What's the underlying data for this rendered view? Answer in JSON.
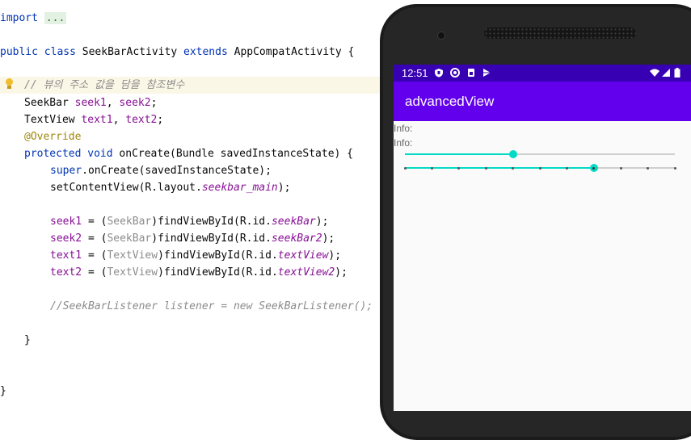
{
  "editor": {
    "line1": {
      "kw": "import",
      "fold": "..."
    },
    "line2": {
      "kw1": "public",
      "kw2": "class",
      "name": "SeekBarActivity",
      "kw3": "extends",
      "parent": "AppCompatActivity",
      "brace": "{"
    },
    "comment": "// 뷰의 주소 값을 담을 참조변수",
    "line4": {
      "type": "SeekBar",
      "a": "seek1",
      "sep": ", ",
      "b": "seek2",
      "end": ";"
    },
    "line5": {
      "type": "TextView",
      "a": "text1",
      "sep": ", ",
      "b": "text2",
      "end": ";"
    },
    "annotation": "@Override",
    "line7": {
      "kw1": "protected",
      "kw2": "void",
      "rest": "onCreate(Bundle savedInstanceState) {"
    },
    "line8": {
      "kw": "super",
      "rest": ".onCreate(savedInstanceState);"
    },
    "line9": {
      "pre": "setContentView(R.layout.",
      "ital": "seekbar_main",
      "post": ");"
    },
    "assign": [
      {
        "field": "seek1",
        "open": " = (",
        "cast": "SeekBar",
        "mid": ")findViewById(R.id.",
        "id": "seekBar",
        "close": ");"
      },
      {
        "field": "seek2",
        "open": " = (",
        "cast": "SeekBar",
        "mid": ")findViewById(R.id.",
        "id": "seekBar2",
        "close": ");"
      },
      {
        "field": "text1",
        "open": " = (",
        "cast": "TextView",
        "mid": ")findViewById(R.id.",
        "id": "textView",
        "close": ");"
      },
      {
        "field": "text2",
        "open": " = (",
        "cast": "TextView",
        "mid": ")findViewById(R.id.",
        "id": "textView2",
        "close": ");"
      }
    ],
    "commented_code": "//SeekBarListener listener = new SeekBarListener();",
    "close_method": "}",
    "close_class": "}"
  },
  "phone": {
    "status_time": "12:51",
    "status_icons": [
      "shield-icon",
      "sync-icon",
      "sim-icon",
      "play-store-icon"
    ],
    "right_icons": [
      "wifi-icon",
      "signal-icon",
      "battery-icon"
    ],
    "app_title": "advancedView",
    "info1": "Info:",
    "info2": "Info:",
    "seek1_fraction": 0.4,
    "seek2_steps": 10,
    "seek2_value": 7,
    "colors": {
      "status": "#3700b3",
      "appbar": "#6200ee",
      "accent": "#03dac5"
    }
  }
}
